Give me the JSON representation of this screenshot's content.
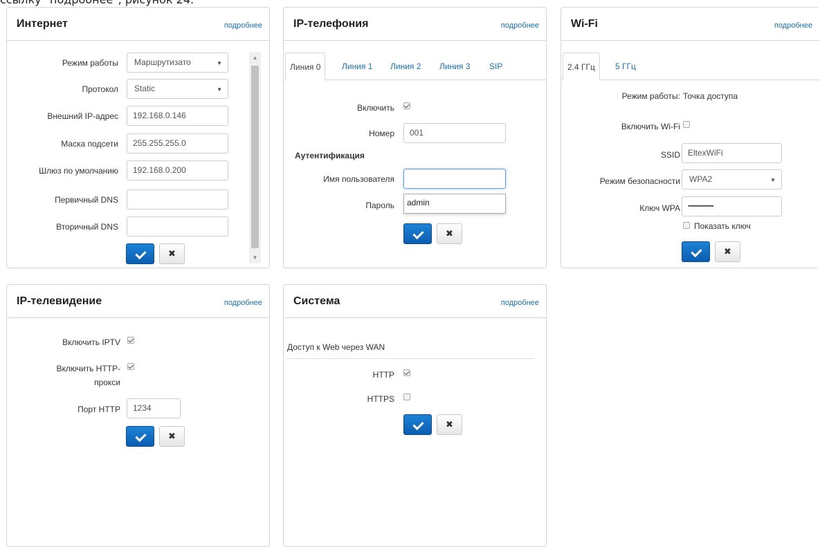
{
  "caption": "ссылку \"подробнее\", рисунок 24.",
  "more_label": "подробнее",
  "internet": {
    "title": "Интернет",
    "mode_label": "Режим работы",
    "mode_value": "Маршрутизато",
    "protocol_label": "Протокол",
    "protocol_value": "Static",
    "ext_ip_label": "Внешний IP-адрес",
    "ext_ip_value": "192.168.0.146",
    "mask_label": "Маска подсети",
    "mask_value": "255.255.255.0",
    "gateway_label": "Шлюз по умолчанию",
    "gateway_value": "192.168.0.200",
    "dns1_label": "Первичный DNS",
    "dns1_value": "",
    "dns2_label": "Вторичный DNS",
    "dns2_value": ""
  },
  "voip": {
    "title": "IP-телефония",
    "tabs": [
      "Линия 0",
      "Линия 1",
      "Линия 2",
      "Линия 3",
      "SIP"
    ],
    "enable_label": "Включить",
    "number_label": "Номер",
    "number_value": "001",
    "auth_title": "Аутентификация",
    "user_label": "Имя пользователя",
    "user_value": "",
    "password_label": "Пароль",
    "autocomplete_option": "admin"
  },
  "wifi": {
    "title": "Wi-Fi",
    "tabs": [
      "2.4 ГГц",
      "5 ГГц"
    ],
    "mode_label": "Режим работы:",
    "mode_value": "Точка доступа",
    "enable_label": "Включить Wi-Fi",
    "ssid_label": "SSID",
    "ssid_value": "EltexWiFi",
    "security_label": "Режим безопасности",
    "security_value": "WPA2",
    "key_label": "Ключ WPA",
    "key_value": "•••••••••••••••••",
    "show_key_label": "Показать ключ"
  },
  "iptv": {
    "title": "IP-телевидение",
    "enable_label": "Включить IPTV",
    "proxy_label_1": "Включить HTTP-",
    "proxy_label_2": "прокси",
    "port_label": "Порт HTTP",
    "port_value": "1234"
  },
  "system": {
    "title": "Система",
    "web_access_label": "Доступ к Web через WAN",
    "http_label": "HTTP",
    "https_label": "HTTPS"
  },
  "cancel_glyph": "✖"
}
